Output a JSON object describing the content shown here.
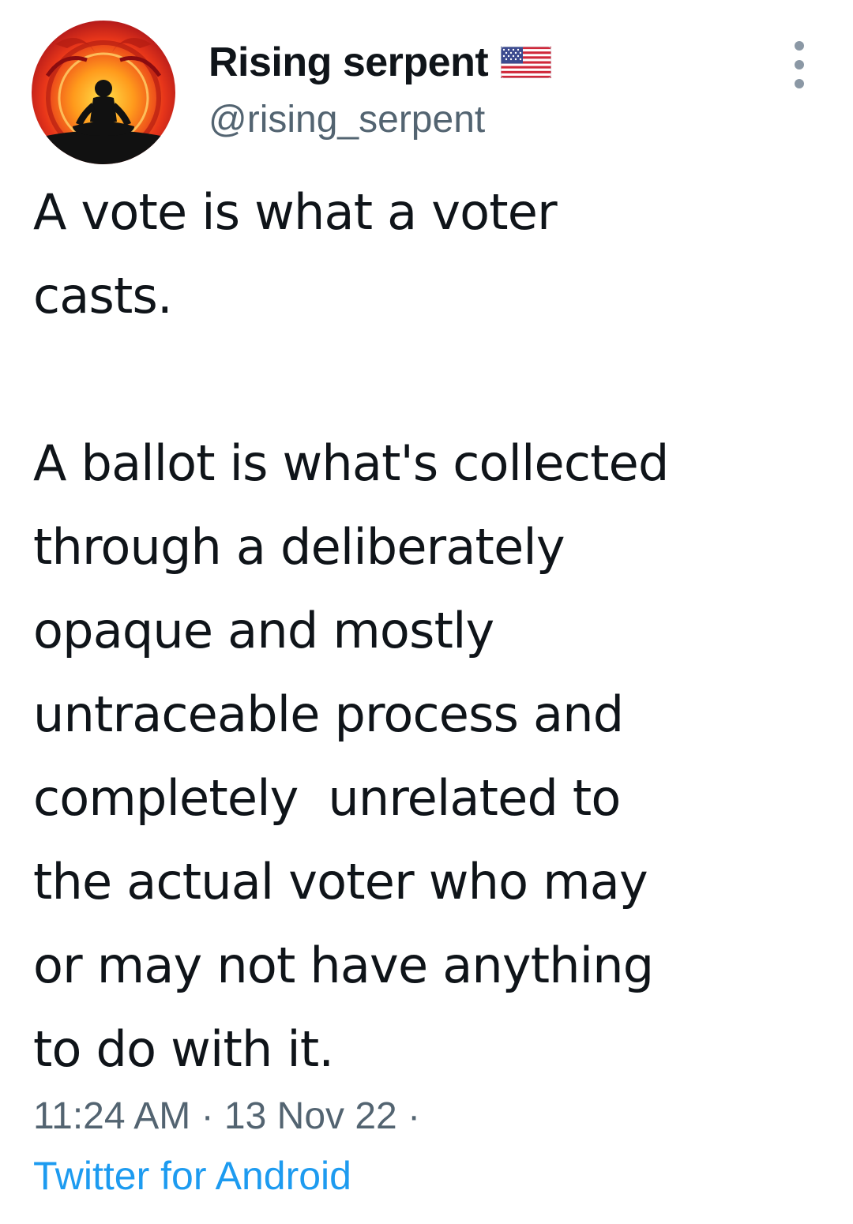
{
  "author": {
    "display_name": "Rising serpent",
    "flag_icon": "us-flag-icon",
    "handle": "@rising_serpent",
    "avatar_icon": "meditating-figure-avatar"
  },
  "tweet": {
    "text": "A vote is what a voter\ncasts.\n\nA ballot is what's collected\nthrough a deliberately\nopaque and mostly\nuntraceable process and\ncompletely  unrelated to\nthe actual voter who may\nor may not have anything\nto do with it.",
    "time": "11:24 AM",
    "date": "13 Nov 22",
    "separator": "·",
    "source": "Twitter for Android"
  },
  "menu": {
    "icon": "more-vertical-icon"
  },
  "colors": {
    "text": "#0f1419",
    "secondary": "#536471",
    "link": "#1d9bf0",
    "background": "#ffffff"
  }
}
